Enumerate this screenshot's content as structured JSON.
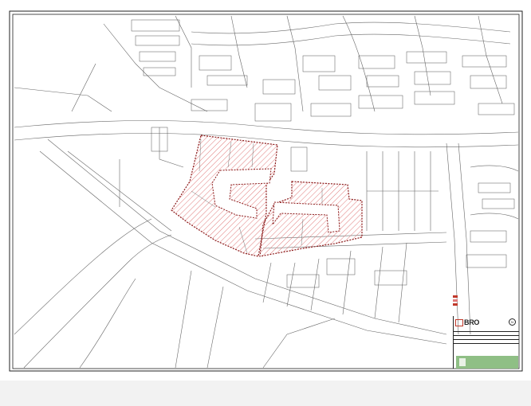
{
  "map": {
    "background": "#ffffff",
    "line_color": "#555555",
    "site_boundary_color": "#c0392b",
    "hatch_color": "#e07a7a"
  },
  "legend": {
    "items": [
      {
        "label": "",
        "color": "#c0392b"
      },
      {
        "label": "",
        "color": "#e07a7a"
      },
      {
        "label": "",
        "color": "#c0392b"
      }
    ]
  },
  "title_block": {
    "logo": "BRO",
    "logo_subtitle": "",
    "north": "N",
    "rows": [
      "",
      "",
      "",
      "",
      ""
    ]
  },
  "footer": {
    "color": "#8fbf85",
    "text": ""
  }
}
